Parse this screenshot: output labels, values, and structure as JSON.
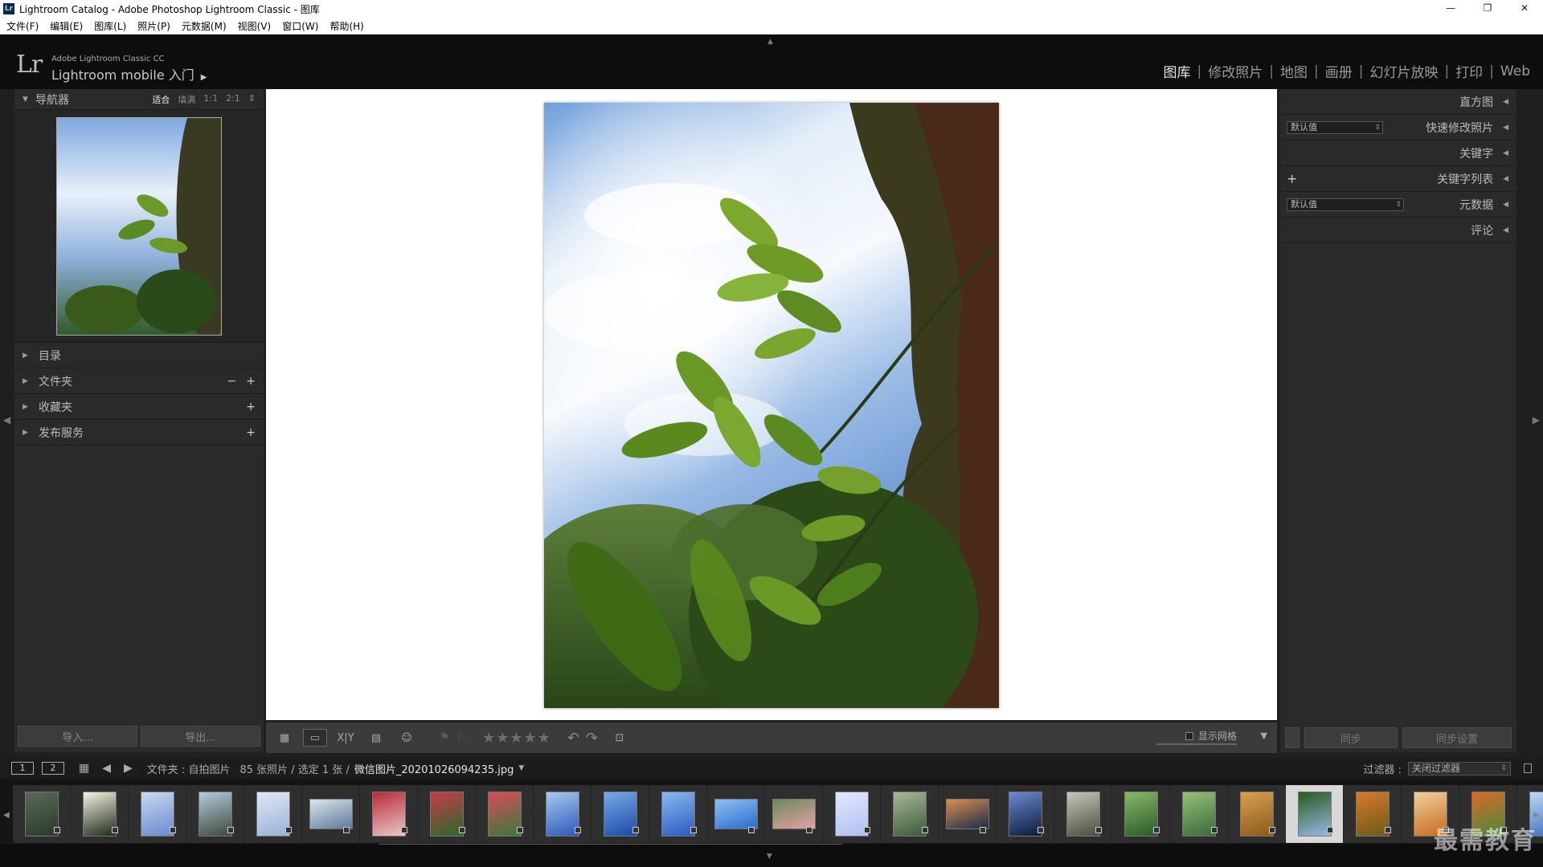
{
  "window": {
    "title": "Lightroom Catalog - Adobe Photoshop Lightroom Classic - 图库",
    "app_icon": "Lr",
    "controls": [
      "—",
      "❐",
      "✕"
    ]
  },
  "menu": [
    "文件(F)",
    "编辑(E)",
    "图库(L)",
    "照片(P)",
    "元数据(M)",
    "视图(V)",
    "窗口(W)",
    "帮助(H)"
  ],
  "identity": {
    "logo": "Lr",
    "product": "Adobe Lightroom Classic CC",
    "mobile": "Lightroom mobile 入门"
  },
  "modules": [
    {
      "label": "图库",
      "active": true
    },
    {
      "label": "修改照片"
    },
    {
      "label": "地图"
    },
    {
      "label": "画册"
    },
    {
      "label": "幻灯片放映"
    },
    {
      "label": "打印"
    },
    {
      "label": "Web"
    }
  ],
  "left_panel": {
    "navigator": {
      "title": "导航器",
      "zoom": [
        "适合",
        "填满",
        "1:1",
        "2:1"
      ],
      "zoom_more": "⇕"
    },
    "sections": [
      {
        "title": "目录",
        "actions": []
      },
      {
        "title": "文件夹",
        "actions": [
          "−",
          "+"
        ]
      },
      {
        "title": "收藏夹",
        "actions": [
          "+"
        ]
      },
      {
        "title": "发布服务",
        "actions": [
          "+"
        ]
      }
    ],
    "import_label": "导入...",
    "export_label": "导出..."
  },
  "right_panel": {
    "histogram": "直方图",
    "quick_develop": {
      "label": "快速修改照片",
      "preset": "默认值"
    },
    "keywording": "关键字",
    "keyword_list": {
      "label": "关键字列表",
      "plus": "+"
    },
    "metadata": {
      "label": "元数据",
      "preset": "默认值"
    },
    "comments": "评论",
    "sync_label": "同步",
    "sync_settings_label": "同步设置"
  },
  "toolbar": {
    "stars": "★★★★★",
    "show_grid_label": "显示网格"
  },
  "filmstrip_header": {
    "monitor1": "1",
    "monitor2": "2",
    "path_prefix": "文件夹 : 自拍图片",
    "count": "85 张照片 / 选定 1 张 /",
    "filename": "微信图片_20201026094235.jpg",
    "filter_label": "过滤器 :",
    "filter_value": "关闭过滤器"
  },
  "filmstrip": {
    "thumbnails": [
      {
        "colors": [
          "#2a3a2a",
          "#5a6a5a"
        ],
        "land": false
      },
      {
        "colors": [
          "#1c2a1a",
          "#f4f4e0"
        ],
        "land": false
      },
      {
        "colors": [
          "#6a8ad0",
          "#c8d8f0"
        ],
        "land": false
      },
      {
        "colors": [
          "#3a4a3a",
          "#b8c8e0"
        ],
        "land": false
      },
      {
        "colors": [
          "#9ab0d8",
          "#e0e8f4"
        ],
        "land": false
      },
      {
        "colors": [
          "#5a7a9a",
          "#dde4ea"
        ],
        "land": true
      },
      {
        "colors": [
          "#e8c8c8",
          "#b82a3a"
        ],
        "land": false
      },
      {
        "colors": [
          "#2a6a2a",
          "#c83a4a"
        ],
        "land": false
      },
      {
        "colors": [
          "#3a7a3a",
          "#d84a5a"
        ],
        "land": false
      },
      {
        "colors": [
          "#2a5ab8",
          "#a8c8f0"
        ],
        "land": false
      },
      {
        "colors": [
          "#1a4aa8",
          "#7aa8e8"
        ],
        "land": false
      },
      {
        "colors": [
          "#2a5ac0",
          "#8ab8f0"
        ],
        "land": false
      },
      {
        "colors": [
          "#2a6ad0",
          "#90c0f0"
        ],
        "land": true
      },
      {
        "colors": [
          "#e8a0a8",
          "#6a8a5a"
        ],
        "land": true
      },
      {
        "colors": [
          "#b0c0f0",
          "#e0e8ff"
        ],
        "land": false
      },
      {
        "colors": [
          "#3a5a3a",
          "#a8b898"
        ],
        "land": false
      },
      {
        "colors": [
          "#1a2a4a",
          "#d89050"
        ],
        "land": true
      },
      {
        "colors": [
          "#0a1a3a",
          "#6a8ad0"
        ],
        "land": false
      },
      {
        "colors": [
          "#4a4a40",
          "#c8c8b8"
        ],
        "land": false
      },
      {
        "colors": [
          "#2a5a2a",
          "#8ab868"
        ],
        "land": false
      },
      {
        "colors": [
          "#3a6a3a",
          "#98c078"
        ],
        "land": false
      },
      {
        "colors": [
          "#8a5a1a",
          "#d8a050"
        ],
        "land": false
      },
      {
        "colors": [
          "#9ab8e8",
          "#2a5a1a"
        ],
        "land": false,
        "selected": true
      },
      {
        "colors": [
          "#6a5a1a",
          "#d87a2a"
        ],
        "land": false
      },
      {
        "colors": [
          "#c86a1a",
          "#f0d0a0"
        ],
        "land": false
      },
      {
        "colors": [
          "#4a8a3a",
          "#d86a2a"
        ],
        "land": false
      },
      {
        "colors": [
          "#3a6ac0",
          "#c0d8f0"
        ],
        "land": false
      }
    ]
  },
  "watermark": "最需教育"
}
